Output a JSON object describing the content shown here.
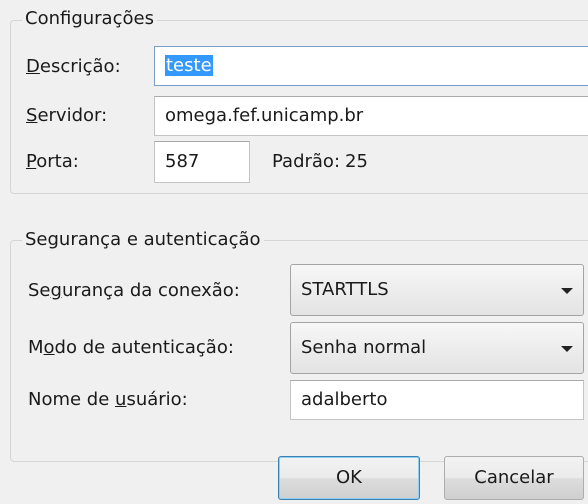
{
  "server_group": {
    "title": "Configurações",
    "description": {
      "mnemonic": "D",
      "rest": "escrição:",
      "value": "teste"
    },
    "server": {
      "mnemonic": "S",
      "rest": "ervidor:",
      "value": "omega.fef.unicamp.br"
    },
    "port": {
      "mnemonic": "P",
      "rest": "orta:",
      "value": "587"
    },
    "default_port": {
      "label": "Padrão:",
      "value": "25"
    }
  },
  "security_group": {
    "title": "Segurança e autenticação",
    "connection_security": {
      "pre": "Se",
      "mnemonic": "g",
      "post": "urança da conexão:",
      "value": "STARTTLS"
    },
    "auth_method": {
      "pre": "M",
      "mnemonic": "o",
      "post": "do de autenticação:",
      "value": "Senha normal"
    },
    "username": {
      "pre": "Nome de ",
      "mnemonic": "u",
      "post": "suário:",
      "value": "adalberto"
    }
  },
  "buttons": {
    "ok": "OK",
    "cancel": "Cancelar"
  }
}
